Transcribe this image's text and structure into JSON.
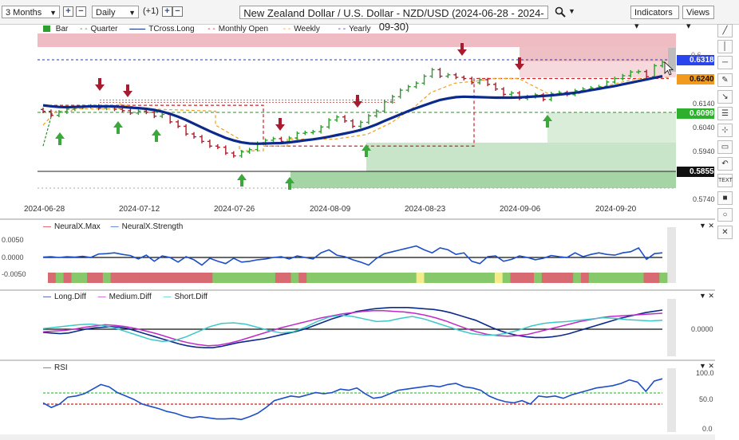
{
  "toolbar": {
    "range": "3 Months",
    "interval": "Daily",
    "offset": "(+1)",
    "title": "New Zealand Dollar / U.S. Dollar - NZD/USD (2024-06-28 - 2024-09-30)",
    "indicators": "Indicators",
    "views": "Views"
  },
  "legend_main": [
    "Bar",
    "Quarter",
    "TCross.Long",
    "Monthly Open",
    "Weekly",
    "Yearly"
  ],
  "legend_nx": [
    "NeuralX.Max",
    "NeuralX.Strength"
  ],
  "legend_diff": [
    "Long.Diff",
    "Medium.Diff",
    "Short.Diff"
  ],
  "legend_rsi": [
    "RSI"
  ],
  "price_tags": {
    "yearly": "0.6318",
    "monthly": "0.6240",
    "quarter": "0.6099",
    "black": "0.5855"
  },
  "price_axis": [
    "0.6240",
    "0.6140",
    "0.6040",
    "0.5940",
    "0.5740"
  ],
  "x_axis": [
    "2024-06-28",
    "2024-07-12",
    "2024-07-26",
    "2024-08-09",
    "2024-08-23",
    "2024-09-06",
    "2024-09-20"
  ],
  "nx_axis": [
    "0.0050",
    "0.0000",
    "-0.0050"
  ],
  "diff_axis": [
    "0.0000"
  ],
  "rsi_axis": [
    "100.0",
    "50.0",
    "0.0"
  ],
  "tools": [
    "pen-icon",
    "vertical-line-icon",
    "horizontal-line-icon",
    "pencil-icon",
    "trend-icon",
    "fib-icon",
    "measure-icon",
    "shape-icon",
    "undo-icon",
    "text-icon",
    "square-icon",
    "circle-icon",
    "close-icon"
  ],
  "tool_text": "TEXT",
  "colors": {
    "bull": "#2e9e2e",
    "bear": "#b01c2c",
    "tcross": "#0c2a8c",
    "yearly": "#2233cc",
    "monthly": "#d0202a",
    "weekly": "#f0a020",
    "quarter": "#2e8b2e"
  },
  "chart_data": {
    "type": "candlestick-ohlc",
    "title": "New Zealand Dollar / U.S. Dollar - NZD/USD (2024-06-28 - 2024-09-30)",
    "close": [
      0.6099,
      0.6082,
      0.6096,
      0.6108,
      0.6116,
      0.612,
      0.6122,
      0.6112,
      0.6118,
      0.6108,
      0.6102,
      0.6092,
      0.61,
      0.6095,
      0.6078,
      0.6086,
      0.6054,
      0.6035,
      0.6002,
      0.599,
      0.597,
      0.595,
      0.5945,
      0.592,
      0.5908,
      0.5925,
      0.5935,
      0.5962,
      0.5975,
      0.5982,
      0.597,
      0.5985,
      0.6005,
      0.6008,
      0.6012,
      0.6032,
      0.6062,
      0.6075,
      0.6058,
      0.6035,
      0.6052,
      0.608,
      0.61,
      0.614,
      0.6162,
      0.619,
      0.6205,
      0.622,
      0.625,
      0.6278,
      0.625,
      0.6256,
      0.6245,
      0.624,
      0.6222,
      0.6235,
      0.6215,
      0.6195,
      0.6172,
      0.6178,
      0.6155,
      0.6162,
      0.617,
      0.615,
      0.6175,
      0.618,
      0.6172,
      0.6188,
      0.6195,
      0.62,
      0.6205,
      0.6225,
      0.624,
      0.6252,
      0.6268,
      0.627,
      0.6248,
      0.6295,
      0.631
    ],
    "tcross_long": [
      0.6125,
      0.6121,
      0.6118,
      0.6117,
      0.6118,
      0.6119,
      0.6121,
      0.612,
      0.6121,
      0.612,
      0.6118,
      0.6115,
      0.6113,
      0.611,
      0.6105,
      0.6098,
      0.6088,
      0.6076,
      0.6062,
      0.6046,
      0.603,
      0.6014,
      0.5999,
      0.5985,
      0.5974,
      0.5966,
      0.5961,
      0.596,
      0.5961,
      0.5962,
      0.5963,
      0.5966,
      0.597,
      0.5975,
      0.5979,
      0.5984,
      0.599,
      0.5997,
      0.6004,
      0.6011,
      0.6019,
      0.603,
      0.6043,
      0.6058,
      0.6072,
      0.6086,
      0.61,
      0.6113,
      0.6125,
      0.6137,
      0.6148,
      0.6155,
      0.616,
      0.6162,
      0.6161,
      0.616,
      0.6159,
      0.6158,
      0.6158,
      0.6158,
      0.6159,
      0.6161,
      0.6163,
      0.6165,
      0.6168,
      0.6171,
      0.6175,
      0.6179,
      0.6184,
      0.619,
      0.6196,
      0.6202,
      0.6208,
      0.6215,
      0.6222,
      0.6229,
      0.6236,
      0.6243,
      0.625
    ],
    "levels": {
      "yearly": 0.6318,
      "monthly_open": 0.624,
      "quarter": 0.6099,
      "black": 0.5855
    },
    "y_range": [
      0.5725,
      0.643
    ],
    "neuralx_strength": [
      0.0001,
      0.0002,
      0.0,
      0.0002,
      0.0001,
      0.0003,
      0.0,
      0.0009,
      0.001,
      0.0012,
      0.0008,
      0.0005,
      -0.0004,
      0.0006,
      -0.001,
      0.0004,
      0.0,
      -0.0012,
      0.0002,
      -0.0006,
      -0.002,
      -0.0002,
      -0.001,
      -0.0016,
      -0.0002,
      -0.0012,
      -0.001,
      -0.0006,
      -0.0004,
      0.0,
      0.0002,
      -0.0004,
      0.0004,
      0.0,
      -0.0004,
      0.0012,
      0.002,
      0.0006,
      0.0002,
      -0.0006,
      -0.0012,
      -0.002,
      -0.0002,
      0.001,
      0.0015,
      0.002,
      0.0025,
      0.003,
      0.002,
      0.0012,
      0.0025,
      0.002,
      0.0008,
      0.0012,
      -0.001,
      -0.0016,
      0.0002,
      0.0004,
      -0.001,
      -0.0005,
      0.0004,
      0.0,
      -0.0006,
      -0.0002,
      0.0005,
      0.0002,
      0.0,
      0.0012,
      0.0002,
      0.0008,
      0.0012,
      0.0008,
      0.0006,
      0.0012,
      0.0015,
      0.0025,
      -0.0005,
      0.001,
      0.0012
    ],
    "neuralx_colors": "RGRGGRRGRRRRRRRRRRRRRGGGGGGGGRRGRGGGGGGGGGGGGGGYGGGGGGGGGYGRRRGRRRRGRGGGGGGGRRG",
    "long_diff": [
      -0.5,
      -0.6,
      -0.7,
      -0.6,
      -0.3,
      0.0,
      0.2,
      0.3,
      0.4,
      0.3,
      0.1,
      -0.3,
      -0.7,
      -1.1,
      -1.5,
      -1.9,
      -2.3,
      -2.6,
      -2.8,
      -2.9,
      -2.9,
      -2.7,
      -2.4,
      -2.1,
      -1.9,
      -1.7,
      -1.5,
      -1.2,
      -0.9,
      -0.6,
      -0.3,
      0.1,
      0.6,
      1.1,
      1.6,
      2.0,
      2.4,
      2.8,
      3.0,
      3.2,
      3.3,
      3.4,
      3.4,
      3.4,
      3.3,
      3.2,
      3.1,
      2.9,
      2.6,
      2.2,
      1.8,
      1.4,
      0.8,
      0.2,
      -0.3,
      -0.7,
      -1.0,
      -1.2,
      -1.3,
      -1.3,
      -1.2,
      -1.0,
      -0.7,
      -0.3,
      0.1,
      0.5,
      0.9,
      1.3,
      1.7,
      2.0,
      2.3,
      2.6,
      2.8,
      3.0
    ],
    "medium_diff": [
      -0.4,
      -0.3,
      -0.2,
      0.0,
      0.3,
      0.5,
      0.7,
      0.6,
      0.4,
      0.1,
      -0.3,
      -0.7,
      -1.2,
      -1.7,
      -2.1,
      -2.4,
      -2.6,
      -2.5,
      -2.2,
      -1.8,
      -1.3,
      -0.8,
      -0.3,
      0.2,
      0.6,
      1.0,
      1.4,
      1.8,
      2.1,
      2.4,
      2.6,
      2.8,
      2.9,
      2.9,
      2.8,
      2.7,
      2.5,
      2.2,
      1.8,
      1.3,
      0.7,
      0.1,
      -0.4,
      -0.8,
      -1.0,
      -1.1,
      -1.0,
      -0.8,
      -0.4,
      0.0,
      0.4,
      0.8,
      1.2,
      1.5,
      1.8,
      2.0,
      2.1,
      2.2,
      2.3,
      2.4,
      2.5
    ],
    "short_diff": [
      0.1,
      0.3,
      0.5,
      0.7,
      0.8,
      0.6,
      0.2,
      -0.4,
      -1.0,
      -1.6,
      -1.9,
      -1.8,
      -1.2,
      -0.4,
      0.4,
      0.9,
      1.0,
      0.8,
      0.3,
      -0.2,
      -0.6,
      -0.4,
      0.3,
      1.2,
      1.9,
      2.2,
      2.0,
      1.6,
      1.2,
      1.3,
      1.7,
      2.0,
      1.6,
      1.0,
      0.4,
      -0.2,
      -0.7,
      -0.9,
      -0.9,
      -0.6,
      -0.1,
      0.5,
      0.9,
      1.1,
      1.2,
      1.4,
      1.6,
      1.8,
      1.7,
      1.5,
      1.4,
      1.3,
      1.4
    ],
    "rsi": [
      48,
      40,
      46,
      58,
      60,
      64,
      72,
      80,
      76,
      66,
      60,
      54,
      46,
      42,
      38,
      33,
      30,
      25,
      22,
      24,
      22,
      20,
      20,
      21,
      19,
      24,
      30,
      40,
      52,
      56,
      60,
      58,
      62,
      66,
      64,
      66,
      72,
      70,
      74,
      64,
      56,
      58,
      64,
      70,
      72,
      74,
      76,
      78,
      76,
      80,
      82,
      76,
      74,
      70,
      60,
      54,
      50,
      48,
      52,
      46,
      60,
      58,
      60,
      56,
      62,
      66,
      70,
      74,
      76,
      78,
      82,
      88,
      84,
      68,
      86,
      90
    ]
  }
}
